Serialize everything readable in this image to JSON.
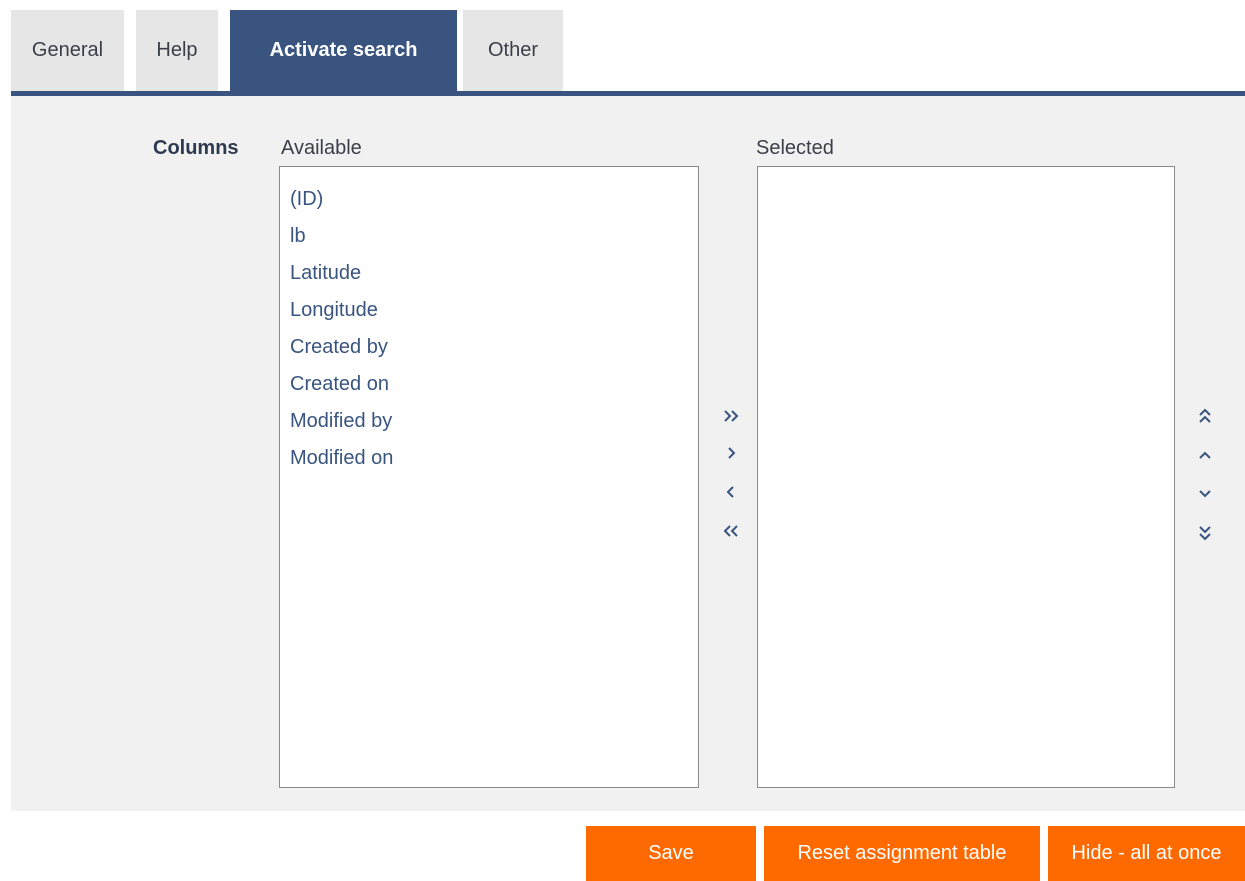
{
  "tabs": [
    {
      "label": "General"
    },
    {
      "label": "Help"
    },
    {
      "label": "Activate search",
      "active": true
    },
    {
      "label": "Other"
    }
  ],
  "columns": {
    "label": "Columns",
    "available_label": "Available",
    "selected_label": "Selected",
    "available_items": [
      "(ID)",
      "lb",
      "Latitude",
      "Longitude",
      "Created by",
      "Created on",
      "Modified by",
      "Modified on"
    ],
    "selected_items": []
  },
  "transfer_controls": [
    "move-all-right-icon",
    "move-right-icon",
    "move-left-icon",
    "move-all-left-icon"
  ],
  "order_controls": [
    "move-top-icon",
    "move-up-icon",
    "move-down-icon",
    "move-bottom-icon"
  ],
  "buttons": {
    "save": "Save",
    "reset": "Reset assignment table",
    "hide": "Hide - all at once"
  },
  "colors": {
    "accent": "#39557f",
    "button": "#ff6a00",
    "panel": "#f1f1f1",
    "tab_inactive": "#e6e6e6"
  }
}
